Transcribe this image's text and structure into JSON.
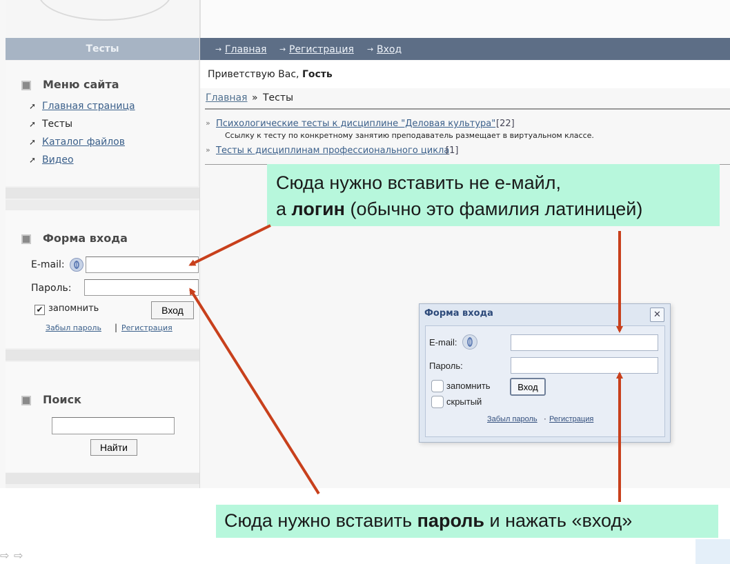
{
  "sidebar": {
    "tests_header": "Тесты",
    "menu_title": "Меню сайта",
    "menu_items": [
      "Главная страница",
      "Тесты",
      "Каталог файлов",
      "Видео"
    ],
    "login_title": "Форма входа",
    "email_label": "E-mail:",
    "password_label": "Пароль:",
    "remember_label": "запомнить",
    "login_button": "Вход",
    "forgot_link": "Забыл пароль",
    "divider": "|",
    "register_link": "Регистрация",
    "search_title": "Поиск",
    "search_button": "Найти"
  },
  "nav": {
    "items": [
      "Главная",
      "Регистрация",
      "Вход"
    ],
    "arrow": "→"
  },
  "main": {
    "greeting_prefix": "Приветствую Вас,",
    "greeting_name": "Гость",
    "breadcrumb_home": "Главная",
    "breadcrumb_sep": "»",
    "breadcrumb_current": "Тесты",
    "category1_title": "Психологические тесты к дисциплине \"Деловая культура\"",
    "category1_count": "[22]",
    "category1_desc": "Ссылку к тесту по конкретному занятию преподаватель размещает в виртуальном классе.",
    "category2_title": "Тесты к дисциплинам профессионального цикла",
    "category2_count": "[1]",
    "bullet": "»"
  },
  "callout_top": {
    "line1": "Сюда нужно вставить не е-майл,",
    "line2_prefix": "а",
    "line2_bold": "логин",
    "line2_suffix": "(обычно это фамилия латиницей)"
  },
  "callout_bottom": {
    "prefix": "Сюда нужно вставить",
    "bold": "пароль",
    "suffix": "и нажать «вход»"
  },
  "modal": {
    "title": "Форма входа",
    "close": "✕",
    "email_label": "E-mail:",
    "password_label": "Пароль:",
    "remember_label": "запомнить",
    "hidden_label": "скрытый",
    "login_button": "Вход",
    "forgot_link": "Забыл пароль",
    "dot": "·",
    "register_link": "Регистрация"
  },
  "colors": {
    "arrow": "#c8401c",
    "callout_bg": "#b7f7dc",
    "nav_bg": "#5d6e86",
    "link": "#3a5f8a"
  },
  "icons": [
    "openid-icon",
    "checkmark-icon",
    "close-icon",
    "arrow-right-icon"
  ]
}
